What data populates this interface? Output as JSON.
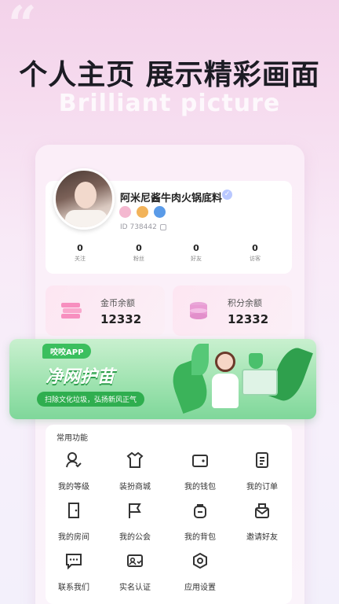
{
  "promo": {
    "headline": "个人主页 展示精彩画面",
    "subheadline": "Brilliant picture"
  },
  "profile": {
    "name": "阿米尼酱牛肉火锅底料",
    "id_label": "ID",
    "id_value": "738442",
    "stats": [
      {
        "value": "0",
        "label": "关注"
      },
      {
        "value": "0",
        "label": "粉丝"
      },
      {
        "value": "0",
        "label": "好友"
      },
      {
        "value": "0",
        "label": "访客"
      }
    ],
    "badge_colors": [
      "#f4b8d0",
      "#f2b35a",
      "#5a9be8"
    ]
  },
  "wallet": {
    "coins_label": "金币余额",
    "coins_value": "12332",
    "points_label": "积分余额",
    "points_value": "12332"
  },
  "banner": {
    "tag": "咬咬APP",
    "title": "净网护苗",
    "subtitle": "扫除文化垃圾，弘扬新风正气"
  },
  "features": {
    "title": "常用功能",
    "items": [
      {
        "label": "我的等级",
        "icon": "user-check-icon"
      },
      {
        "label": "装扮商城",
        "icon": "shirt-icon"
      },
      {
        "label": "我的钱包",
        "icon": "wallet-icon"
      },
      {
        "label": "我的订单",
        "icon": "order-list-icon"
      },
      {
        "label": "我的房间",
        "icon": "door-icon"
      },
      {
        "label": "我的公会",
        "icon": "flag-icon"
      },
      {
        "label": "我的背包",
        "icon": "backpack-icon"
      },
      {
        "label": "邀请好友",
        "icon": "invite-envelope-icon"
      },
      {
        "label": "联系我们",
        "icon": "chat-icon"
      },
      {
        "label": "实名认证",
        "icon": "id-card-icon"
      },
      {
        "label": "应用设置",
        "icon": "settings-hexagon-icon"
      }
    ]
  },
  "colors": {
    "accent_green": "#3bbf5e",
    "wallet_pink": "#fde6f2"
  }
}
